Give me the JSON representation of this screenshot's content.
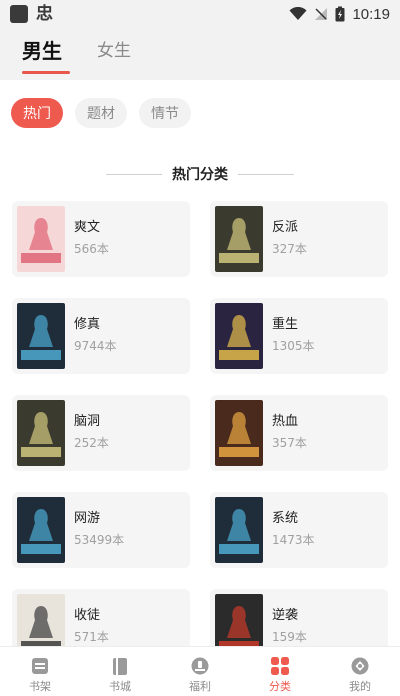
{
  "status_bar": {
    "time": "10:19",
    "app_glyph": "忠"
  },
  "gender_tabs": [
    {
      "label": "男生",
      "active": true
    },
    {
      "label": "女生",
      "active": false
    }
  ],
  "filter_chips": [
    {
      "label": "热门",
      "active": true
    },
    {
      "label": "题材",
      "active": false
    },
    {
      "label": "情节",
      "active": false
    }
  ],
  "section_title": "热门分类",
  "categories": [
    {
      "name": "爽文",
      "count": "566本",
      "cover_color": "#f6d7d7",
      "cover_accent": "#e06a7a"
    },
    {
      "name": "反派",
      "count": "327本",
      "cover_color": "#3b3a2e",
      "cover_accent": "#c9c07a"
    },
    {
      "name": "修真",
      "count": "9744本",
      "cover_color": "#1f2d3b",
      "cover_accent": "#4aa3c9"
    },
    {
      "name": "重生",
      "count": "1305本",
      "cover_color": "#2a2440",
      "cover_accent": "#d9b34a"
    },
    {
      "name": "脑洞",
      "count": "252本",
      "cover_color": "#3b3a2e",
      "cover_accent": "#c9c07a"
    },
    {
      "name": "热血",
      "count": "357本",
      "cover_color": "#4a2a1c",
      "cover_accent": "#e0a040"
    },
    {
      "name": "网游",
      "count": "53499本",
      "cover_color": "#1f2d3b",
      "cover_accent": "#4aa3c9"
    },
    {
      "name": "系统",
      "count": "1473本",
      "cover_color": "#1f2d3b",
      "cover_accent": "#4aa3c9"
    },
    {
      "name": "收徒",
      "count": "571本",
      "cover_color": "#e8e4dc",
      "cover_accent": "#444444"
    },
    {
      "name": "逆袭",
      "count": "159本",
      "cover_color": "#2b2b2b",
      "cover_accent": "#c0392b"
    }
  ],
  "bottom_nav": [
    {
      "label": "书架",
      "icon": "bookshelf-icon",
      "active": false
    },
    {
      "label": "书城",
      "icon": "book-icon",
      "active": false
    },
    {
      "label": "福利",
      "icon": "gift-icon",
      "active": false
    },
    {
      "label": "分类",
      "icon": "category-icon",
      "active": true
    },
    {
      "label": "我的",
      "icon": "profile-icon",
      "active": false
    }
  ],
  "colors": {
    "accent": "#ef5a4f",
    "card_bg": "#f5f5f5",
    "header_bg": "#f2f2f2"
  }
}
